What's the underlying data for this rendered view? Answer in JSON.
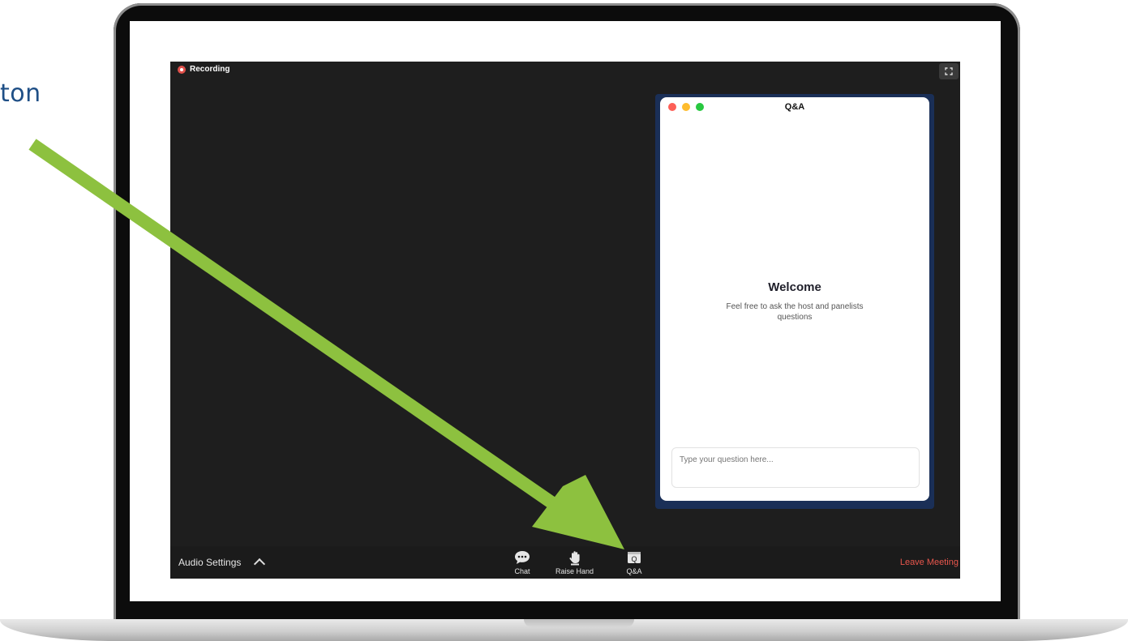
{
  "caption": {
    "text": "ton"
  },
  "zoom": {
    "recording_label": "Recording",
    "qa_panel": {
      "title": "Q&A",
      "welcome_title": "Welcome",
      "welcome_text": "Feel free to ask the host and panelists questions",
      "input_placeholder": "Type your question here..."
    },
    "toolbar": {
      "audio_settings_label": "Audio Settings",
      "chat_label": "Chat",
      "raise_hand_label": "Raise Hand",
      "qa_label": "Q&A",
      "leave_label": "Leave Meeting"
    }
  },
  "colors": {
    "arrow": "#8dc13f",
    "leave": "#e8564c",
    "qa_frame": "#1a2f57"
  },
  "icons": [
    "recording-dot-icon",
    "fullscreen-icon",
    "chat-bubble-icon",
    "raise-hand-icon",
    "qa-icon",
    "chevron-up-icon"
  ]
}
